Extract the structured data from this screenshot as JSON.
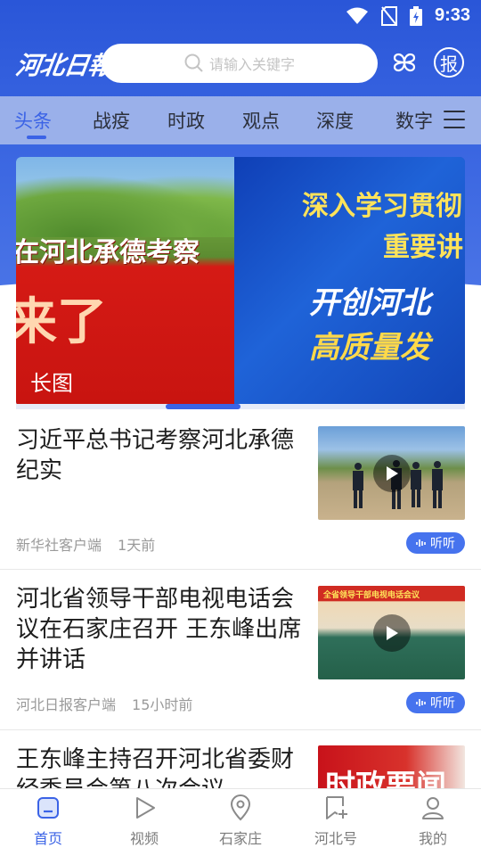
{
  "status_bar": {
    "time": "9:33"
  },
  "header": {
    "logo": "河北日報",
    "search_placeholder": "请输入关键字",
    "apps_icon": "grid-icon",
    "newspaper_icon_label": "报"
  },
  "tabs": [
    {
      "label": "头条",
      "active": true
    },
    {
      "label": "战疫",
      "active": false
    },
    {
      "label": "时政",
      "active": false
    },
    {
      "label": "观点",
      "active": false
    },
    {
      "label": "深度",
      "active": false
    },
    {
      "label": "数字",
      "active": false
    }
  ],
  "banner": {
    "left_title": "在河北承德考察",
    "left_big": "来了",
    "left_tag": "长图",
    "right_line1": "深入学习贯彻",
    "right_line2": "重要讲",
    "right_line3": "开创河北",
    "right_line4": "高质量发"
  },
  "news": [
    {
      "title": "习近平总书记考察河北承德纪实",
      "source": "新华社客户端",
      "time": "1天前",
      "listen": "听听",
      "has_video": true
    },
    {
      "title": "河北省领导干部电视电话会议在石家庄召开  王东峰出席并讲话",
      "source": "河北日报客户端",
      "time": "15小时前",
      "listen": "听听",
      "has_video": true,
      "thumb_text": "全省领导干部电视电话会议"
    },
    {
      "title": "王东峰主持召开河北省委财经委员会第八次会议",
      "thumb_text": "时政要闻"
    }
  ],
  "bottom_nav": [
    {
      "label": "首页",
      "icon": "home-icon",
      "active": true
    },
    {
      "label": "视频",
      "icon": "play-icon",
      "active": false
    },
    {
      "label": "石家庄",
      "icon": "location-icon",
      "active": false
    },
    {
      "label": "河北号",
      "icon": "bookmark-add-icon",
      "active": false
    },
    {
      "label": "我的",
      "icon": "user-icon",
      "active": false
    }
  ],
  "colors": {
    "brand": "#3b63e6",
    "listen_badge": "#4673ee"
  }
}
